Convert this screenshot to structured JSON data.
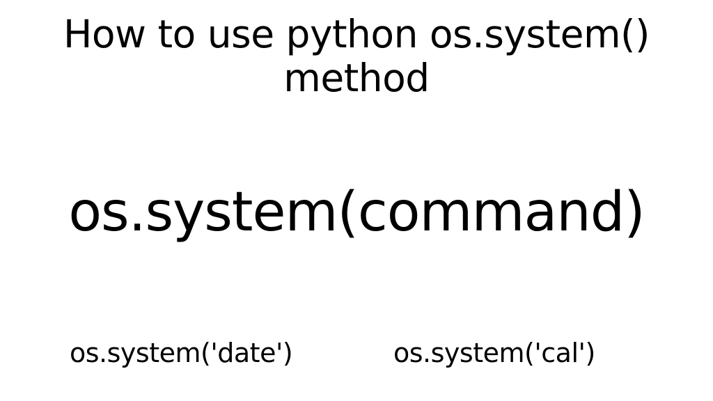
{
  "title": "How to use python os.system() method",
  "syntax": "os.system(command)",
  "examples": {
    "left": "os.system('date')",
    "right": "os.system('cal')"
  }
}
